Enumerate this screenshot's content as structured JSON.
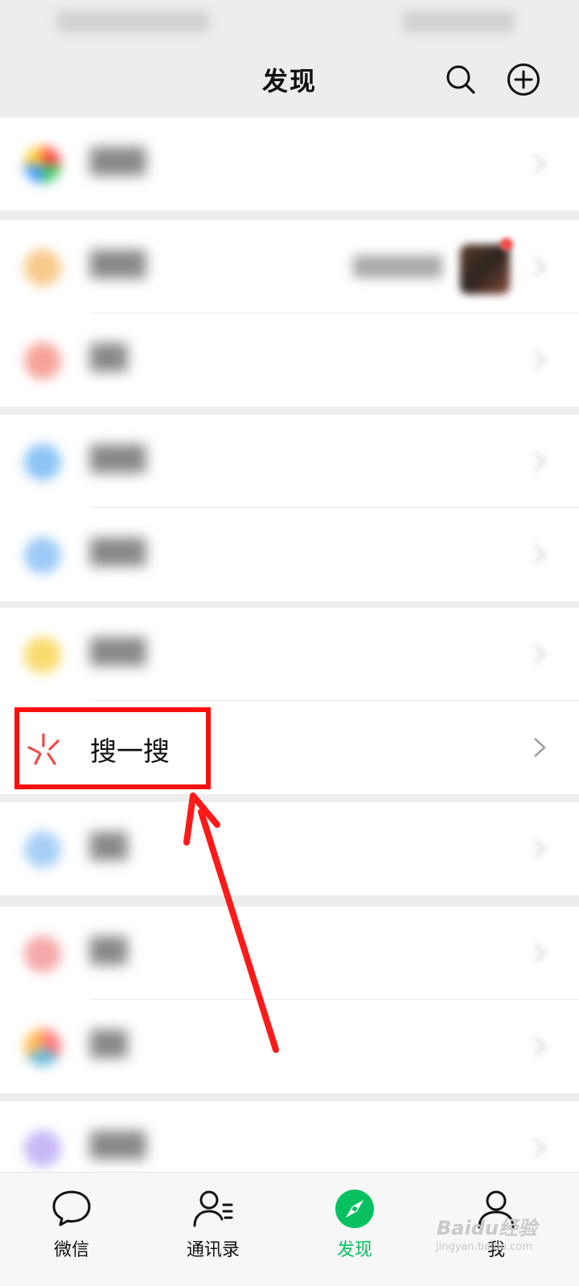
{
  "header": {
    "title": "发现"
  },
  "focus_item": {
    "label": "搜一搜"
  },
  "tabbar": {
    "tabs": [
      {
        "label": "微信",
        "icon": "chat-bubble-icon"
      },
      {
        "label": "通讯录",
        "icon": "contacts-icon"
      },
      {
        "label": "发现",
        "icon": "compass-icon",
        "active": true
      },
      {
        "label": "我",
        "icon": "person-icon"
      }
    ]
  },
  "colors": {
    "accent": "#07c160",
    "highlight": "#ff0d0d",
    "background": "#ededed"
  },
  "watermark": {
    "main": "Baidu经验",
    "sub": "jingyan.baidu.com"
  }
}
